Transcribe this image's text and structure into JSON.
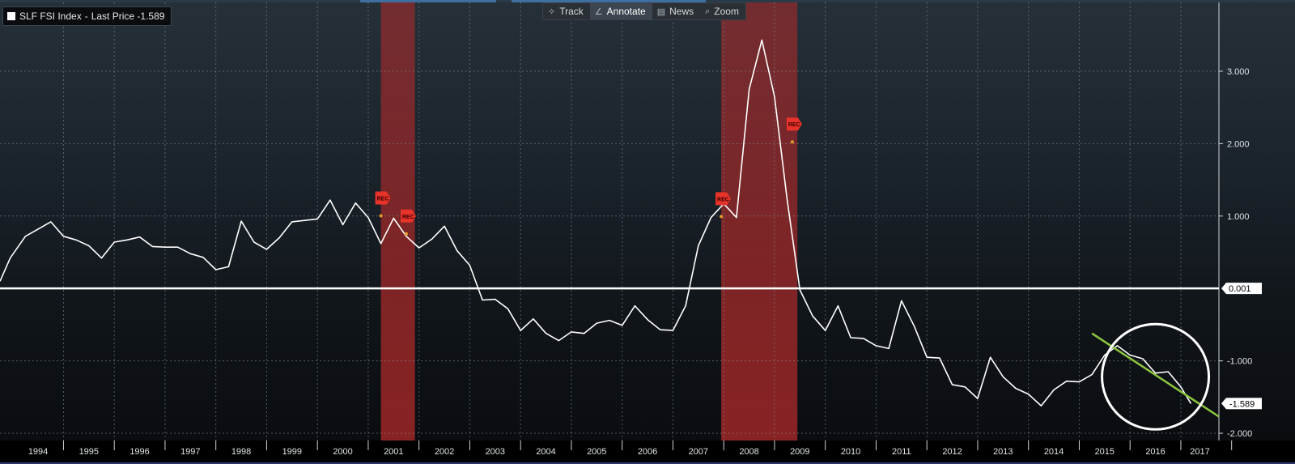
{
  "legend": {
    "ticker": "SLF FSI Index",
    "field": "Last Price",
    "value": "-1.589"
  },
  "toolbar": {
    "items": [
      {
        "label": "Track",
        "icon": "crosshair-icon"
      },
      {
        "label": "Annotate",
        "icon": "pencil-icon"
      },
      {
        "label": "News",
        "icon": "news-icon"
      },
      {
        "label": "Zoom",
        "icon": "magnifier-icon"
      }
    ]
  },
  "colors": {
    "series": "#ffffff",
    "trendline": "#8dc63f",
    "recession_band": "#b22a2a",
    "recession_marker": "#e8332a",
    "grid": "#8a949c"
  },
  "chart_data": {
    "type": "line",
    "series": [
      {
        "values": [
          [
            1993.75,
            0.1
          ],
          [
            1993.95,
            0.42
          ],
          [
            1994.25,
            0.72
          ],
          [
            1994.5,
            0.82
          ],
          [
            1994.75,
            0.92
          ],
          [
            1995.0,
            0.72
          ],
          [
            1995.25,
            0.67
          ],
          [
            1995.5,
            0.59
          ],
          [
            1995.75,
            0.42
          ],
          [
            1996.0,
            0.64
          ],
          [
            1996.25,
            0.67
          ],
          [
            1996.5,
            0.71
          ],
          [
            1996.75,
            0.58
          ],
          [
            1997.0,
            0.57
          ],
          [
            1997.25,
            0.57
          ],
          [
            1997.5,
            0.48
          ],
          [
            1997.75,
            0.43
          ],
          [
            1998.0,
            0.26
          ],
          [
            1998.25,
            0.3
          ],
          [
            1998.5,
            0.93
          ],
          [
            1998.75,
            0.64
          ],
          [
            1999.0,
            0.54
          ],
          [
            1999.25,
            0.7
          ],
          [
            1999.5,
            0.92
          ],
          [
            1999.75,
            0.94
          ],
          [
            2000.0,
            0.96
          ],
          [
            2000.25,
            1.22
          ],
          [
            2000.5,
            0.88
          ],
          [
            2000.75,
            1.18
          ],
          [
            2001.0,
            0.98
          ],
          [
            2001.25,
            0.62
          ],
          [
            2001.5,
            0.97
          ],
          [
            2001.75,
            0.72
          ],
          [
            2002.0,
            0.56
          ],
          [
            2002.25,
            0.68
          ],
          [
            2002.5,
            0.86
          ],
          [
            2002.75,
            0.52
          ],
          [
            2003.0,
            0.32
          ],
          [
            2003.25,
            -0.16
          ],
          [
            2003.5,
            -0.15
          ],
          [
            2003.75,
            -0.28
          ],
          [
            2004.0,
            -0.58
          ],
          [
            2004.25,
            -0.42
          ],
          [
            2004.5,
            -0.62
          ],
          [
            2004.75,
            -0.72
          ],
          [
            2005.0,
            -0.6
          ],
          [
            2005.25,
            -0.62
          ],
          [
            2005.5,
            -0.48
          ],
          [
            2005.75,
            -0.44
          ],
          [
            2006.0,
            -0.51
          ],
          [
            2006.25,
            -0.24
          ],
          [
            2006.5,
            -0.43
          ],
          [
            2006.75,
            -0.57
          ],
          [
            2007.0,
            -0.58
          ],
          [
            2007.25,
            -0.24
          ],
          [
            2007.5,
            0.59
          ],
          [
            2007.75,
            0.98
          ],
          [
            2008.0,
            1.17
          ],
          [
            2008.25,
            0.98
          ],
          [
            2008.5,
            2.75
          ],
          [
            2008.75,
            3.43
          ],
          [
            2009.0,
            2.65
          ],
          [
            2009.25,
            1.22
          ],
          [
            2009.5,
            -0.02
          ],
          [
            2009.75,
            -0.38
          ],
          [
            2010.0,
            -0.58
          ],
          [
            2010.25,
            -0.24
          ],
          [
            2010.5,
            -0.68
          ],
          [
            2010.75,
            -0.69
          ],
          [
            2011.0,
            -0.79
          ],
          [
            2011.25,
            -0.83
          ],
          [
            2011.5,
            -0.17
          ],
          [
            2011.75,
            -0.52
          ],
          [
            2012.0,
            -0.95
          ],
          [
            2012.25,
            -0.96
          ],
          [
            2012.5,
            -1.33
          ],
          [
            2012.75,
            -1.36
          ],
          [
            2013.0,
            -1.52
          ],
          [
            2013.25,
            -0.95
          ],
          [
            2013.5,
            -1.22
          ],
          [
            2013.75,
            -1.38
          ],
          [
            2014.0,
            -1.46
          ],
          [
            2014.25,
            -1.62
          ],
          [
            2014.5,
            -1.4
          ],
          [
            2014.75,
            -1.28
          ],
          [
            2015.0,
            -1.29
          ],
          [
            2015.25,
            -1.19
          ],
          [
            2015.5,
            -0.92
          ],
          [
            2015.75,
            -0.79
          ],
          [
            2016.0,
            -0.92
          ],
          [
            2016.25,
            -0.97
          ],
          [
            2016.5,
            -1.17
          ],
          [
            2016.75,
            -1.15
          ],
          [
            2017.0,
            -1.36
          ],
          [
            2017.2,
            -1.59
          ]
        ]
      }
    ],
    "x_tick_labels": [
      "1994",
      "1995",
      "1996",
      "1997",
      "1998",
      "1999",
      "2000",
      "2001",
      "2002",
      "2003",
      "2004",
      "2005",
      "2006",
      "2007",
      "2008",
      "2009",
      "2010",
      "2011",
      "2012",
      "2013",
      "2014",
      "2015",
      "2016",
      "2017"
    ],
    "y_tick_labels": [
      {
        "value": 3,
        "label": "3.000"
      },
      {
        "value": 2,
        "label": "2.000"
      },
      {
        "value": 1,
        "label": "1.000"
      },
      {
        "value": -1,
        "label": "-1.000"
      },
      {
        "value": -2,
        "label": "-2.000"
      }
    ],
    "xlim": [
      1993.75,
      2017.75
    ],
    "ylim": [
      -2.1,
      3.95
    ],
    "grid": true,
    "y_axis_side": "right",
    "horizontal_line": {
      "value": 0.001,
      "label": "0.001"
    },
    "last_value": {
      "value": -1.589,
      "label": "-1.589"
    },
    "recession_periods": [
      [
        2001.25,
        2001.92
      ],
      [
        2007.95,
        2009.45
      ]
    ],
    "recession_markers": [
      {
        "x": 2001.25,
        "y": 1.25,
        "label": "REC"
      },
      {
        "x": 2001.75,
        "y": 1.0,
        "label": "REC"
      },
      {
        "x": 2007.95,
        "y": 1.24,
        "label": "REC"
      },
      {
        "x": 2009.35,
        "y": 2.27,
        "label": "REC"
      }
    ],
    "trendline": {
      "from": [
        2015.25,
        -0.62
      ],
      "to": [
        2017.75,
        -1.77
      ]
    },
    "highlight_circle": {
      "center": [
        2016.5,
        -1.22
      ]
    }
  }
}
